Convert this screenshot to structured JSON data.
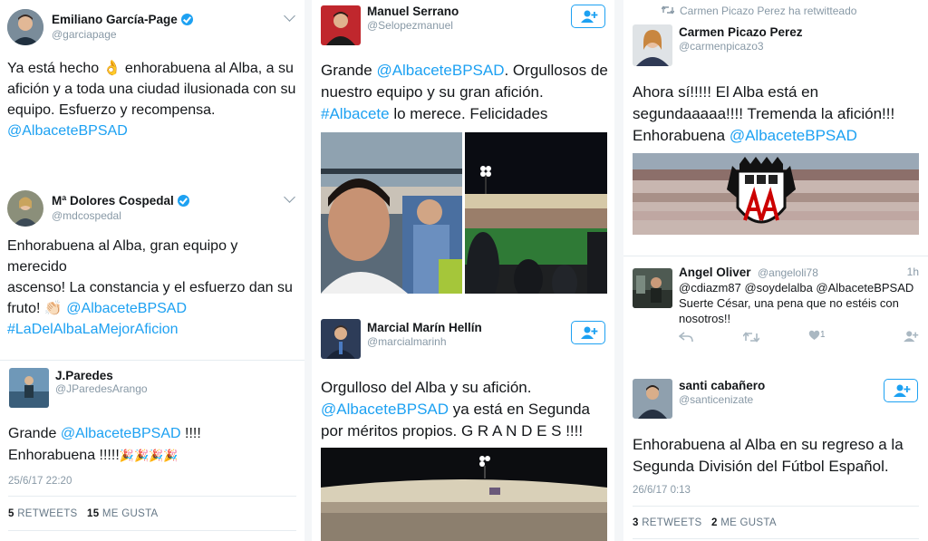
{
  "tweets": {
    "garcia": {
      "name": "Emiliano García-Page",
      "handle": "@garciapage",
      "text_1": "Ya está hecho ",
      "emoji": "👌",
      "text_2": " enhorabuena al Alba, a su",
      "line_2": "afición y a toda una ciudad ilusionada con su",
      "line_3": "equipo. Esfuerzo y recompensa.",
      "mention": "@AlbaceteBPSAD"
    },
    "cospedal": {
      "name": "Mª Dolores Cospedal",
      "handle": "@mdcospedal",
      "line_1": "Enhorabuena al Alba, gran equipo y merecido",
      "line_2": "ascenso! La constancia y el esfuerzo dan su",
      "line_3a": "fruto! ",
      "emoji": "👏🏻",
      "mention": " @AlbaceteBPSAD",
      "hashtag": "#LaDelAlbaLaMejorAficion"
    },
    "paredes": {
      "name": "J.Paredes",
      "handle": "@JParedesArango",
      "text_1": "Grande ",
      "mention": "@AlbaceteBPSAD",
      "text_2": " !!!!",
      "line_2": "Enhorabuena !!!!!",
      "emoji": "🎉🎉🎉🎉",
      "timestamp": "25/6/17 22:20",
      "retweets_count": "5",
      "retweets_label": "RETWEETS",
      "likes_count": "15",
      "likes_label": "ME GUSTA"
    },
    "serrano": {
      "name": "Manuel Serrano",
      "handle": "@Selopezmanuel",
      "text_1": "Grande  ",
      "mention": "@AlbaceteBPSAD",
      "text_2": ". Orgullosos de",
      "line_2": "nuestro equipo y su gran afición.",
      "hashtag": "#Albacete",
      "line_3": " lo merece. Felicidades"
    },
    "marin": {
      "name": "Marcial Marín Hellín",
      "handle": "@marcialmarinh",
      "line_1": "Orgulloso del Alba y su afición.",
      "mention": "@AlbaceteBPSAD",
      "line_2": " ya está en Segunda",
      "line_3": "por méritos propios. G R A N D E S !!!!"
    },
    "picazo": {
      "retweet_note": "Carmen Picazo Perez ha retwitteado",
      "name": "Carmen Picazo Perez",
      "handle": "@carmenpicazo3",
      "line_1": "Ahora sí!!!!! El Alba está en",
      "line_2": "segundaaaaa!!!! Tremenda la afición!!!",
      "line_3": "Enhorabuena ",
      "mention": "@AlbaceteBPSAD"
    },
    "oliver": {
      "name": "Angel Oliver",
      "handle": "@angeloli78",
      "time": "1h",
      "line_1": "@cdiazm87 @soydelalba @AlbaceteBPSAD",
      "line_2": "Suerte César, una pena que no estéis con",
      "line_3": "nosotros!!",
      "like_count": "1"
    },
    "cabanero": {
      "name": "santi cabañero",
      "handle": "@santicenizate",
      "line_1": "Enhorabuena al Alba en su regreso a la",
      "line_2": "Segunda División del Fútbol Español.",
      "timestamp": "26/6/17 0:13",
      "retweets_count": "3",
      "retweets_label": "RETWEETS",
      "likes_count": "2",
      "likes_label": "ME GUSTA"
    }
  },
  "colors": {
    "link": "#1da1f2",
    "text": "#14171a",
    "muted": "#8899a6"
  },
  "icons": [
    "verified-icon",
    "chevron-down-icon",
    "follow-icon",
    "retweet-icon",
    "reply-icon",
    "heart-icon"
  ]
}
